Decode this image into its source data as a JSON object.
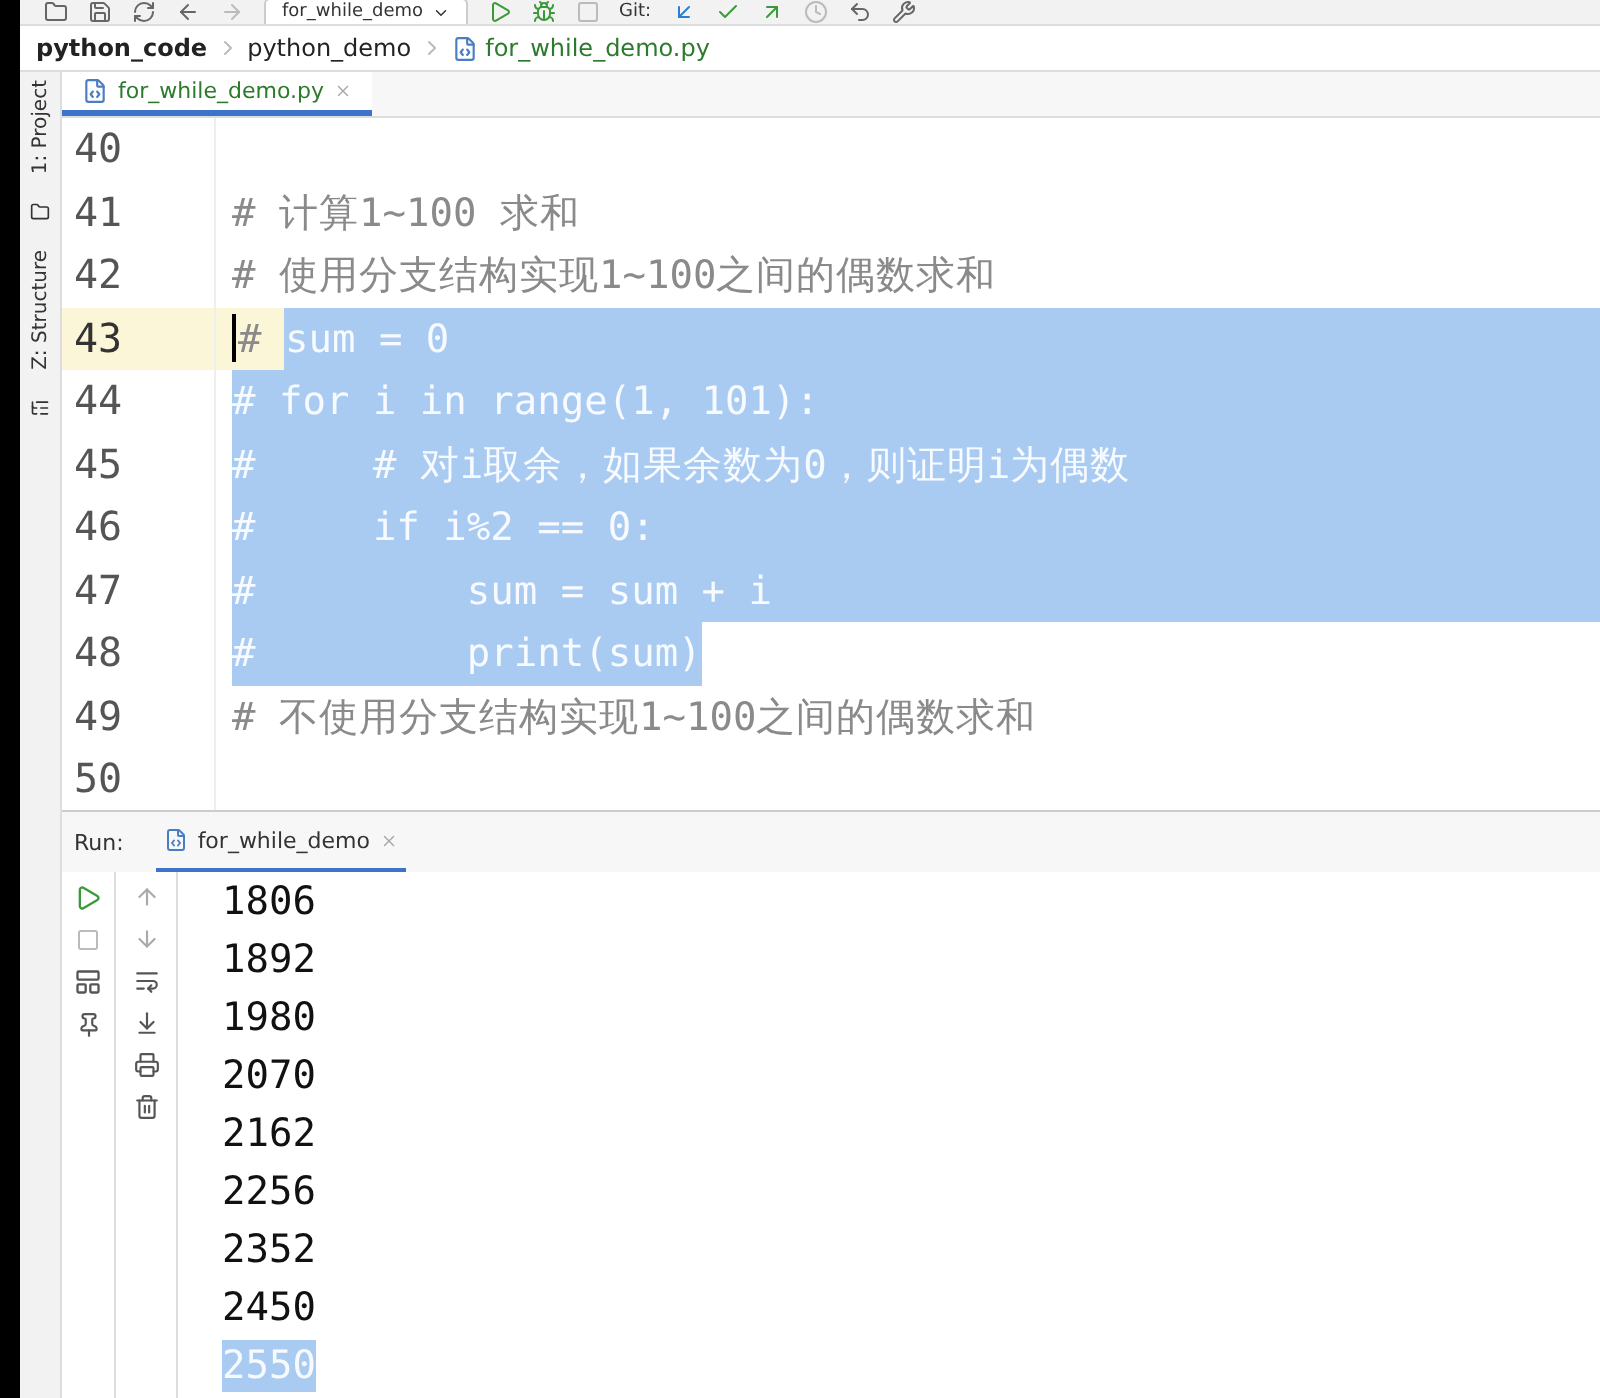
{
  "toolbar": {
    "run_config": "for_while_demo",
    "git_label": "Git:"
  },
  "breadcrumbs": [
    {
      "label": "python_code",
      "kind": "root"
    },
    {
      "label": "python_demo",
      "kind": "folder"
    },
    {
      "label": "for_while_demo.py",
      "kind": "file"
    }
  ],
  "side_tools": [
    {
      "label": "1: Project",
      "kind": "folder"
    },
    {
      "label": "Z: Structure",
      "kind": "structure"
    }
  ],
  "editor_tabs": [
    {
      "label": "for_while_demo.py",
      "selected": true
    }
  ],
  "lines": [
    {
      "number": "40",
      "current": false,
      "selected_to_end": false
    },
    {
      "number": "41",
      "current": false,
      "selected_to_end": false,
      "parts": [
        {
          "text": "# 计算1~100 求和",
          "selected": false
        }
      ]
    },
    {
      "number": "42",
      "current": false,
      "selected_to_end": false,
      "parts": [
        {
          "text": "# 使用分支结构实现1~100之间的偶数求和",
          "selected": false
        }
      ]
    },
    {
      "number": "43",
      "current": true,
      "selected_to_end": true,
      "parts": [
        {
          "text": "# ",
          "selected": false
        },
        {
          "text": "sum = 0",
          "selected": true
        }
      ]
    },
    {
      "number": "44",
      "current": false,
      "selected_to_end": true,
      "parts": [
        {
          "text": "# for i in range(1, 101):",
          "selected": true
        }
      ]
    },
    {
      "number": "45",
      "current": false,
      "selected_to_end": true,
      "parts": [
        {
          "text": "#     # 对i取余，如果余数为0，则证明i为偶数",
          "selected": true
        }
      ]
    },
    {
      "number": "46",
      "current": false,
      "selected_to_end": true,
      "parts": [
        {
          "text": "#     if i%2 == 0:",
          "selected": true
        }
      ]
    },
    {
      "number": "47",
      "current": false,
      "selected_to_end": true,
      "parts": [
        {
          "text": "#         sum = sum + i",
          "selected": true
        }
      ]
    },
    {
      "number": "48",
      "current": false,
      "selected_to_end": false,
      "parts": [
        {
          "text": "#         print(sum)",
          "selected": true
        }
      ]
    },
    {
      "number": "49",
      "current": false,
      "selected_to_end": false,
      "parts": [
        {
          "text": "# 不使用分支结构实现1~100之间的偶数求和",
          "selected": false
        }
      ]
    },
    {
      "number": "50",
      "current": false,
      "selected_to_end": false
    }
  ],
  "run_panel": {
    "label": "Run:",
    "tabs": [
      {
        "label": "for_while_demo",
        "selected": true
      }
    ],
    "output": [
      {
        "text": "1806",
        "selected": false
      },
      {
        "text": "1892",
        "selected": false
      },
      {
        "text": "1980",
        "selected": false
      },
      {
        "text": "2070",
        "selected": false
      },
      {
        "text": "2162",
        "selected": false
      },
      {
        "text": "2256",
        "selected": false
      },
      {
        "text": "2352",
        "selected": false
      },
      {
        "text": "2450",
        "selected": false
      },
      {
        "text": "2550",
        "selected": true
      }
    ]
  }
}
